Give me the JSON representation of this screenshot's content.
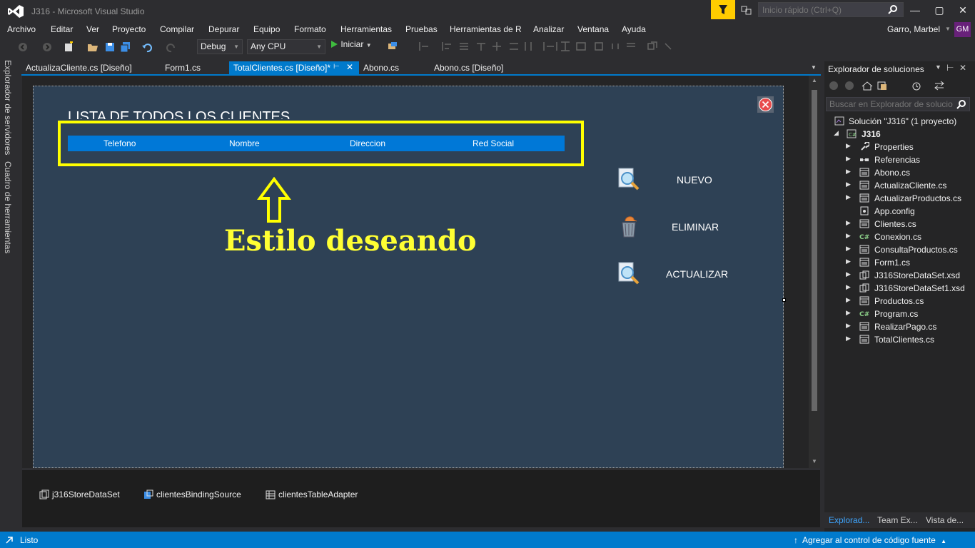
{
  "window": {
    "title": "J316 - Microsoft Visual Studio",
    "quick_launch_placeholder": "Inicio rápido (Ctrl+Q)",
    "user_name": "Garro, Marbel",
    "user_initials": "GM"
  },
  "menu": [
    "Archivo",
    "Editar",
    "Ver",
    "Proyecto",
    "Compilar",
    "Depurar",
    "Equipo",
    "Formato",
    "Herramientas",
    "Pruebas",
    "Herramientas de R",
    "Analizar",
    "Ventana",
    "Ayuda"
  ],
  "toolbar": {
    "config": "Debug",
    "platform": "Any CPU",
    "start_label": "Iniciar"
  },
  "left_tabs": [
    "Explorador de servidores",
    "Cuadro de herramientas"
  ],
  "doc_tabs": [
    {
      "label": "ActualizaCliente.cs [Diseño]",
      "active": false
    },
    {
      "label": "Form1.cs",
      "active": false
    },
    {
      "label": "TotalClientes.cs [Diseño]*",
      "active": true
    },
    {
      "label": "Abono.cs",
      "active": false
    },
    {
      "label": "Abono.cs [Diseño]",
      "active": false
    }
  ],
  "form": {
    "title": "LISTA DE TODOS LOS CLIENTES",
    "columns": [
      "Telefono",
      "Nombre",
      "Direccion",
      "Red Social"
    ],
    "annotation": "Estilo deseando",
    "buttons": [
      "NUEVO",
      "ELIMINAR",
      "ACTUALIZAR"
    ]
  },
  "tray": [
    "j316StoreDataSet",
    "clientesBindingSource",
    "clientesTableAdapter"
  ],
  "solution_explorer": {
    "title": "Explorador de soluciones",
    "search_placeholder": "Buscar en Explorador de solucio",
    "solution": "Solución \"J316\" (1 proyecto)",
    "project": "J316",
    "items": [
      {
        "label": "Properties",
        "icon": "wrench-icon",
        "expandable": true
      },
      {
        "label": "Referencias",
        "icon": "references-icon",
        "expandable": true
      },
      {
        "label": "Abono.cs",
        "icon": "form-icon",
        "expandable": true
      },
      {
        "label": "ActualizaCliente.cs",
        "icon": "form-icon",
        "expandable": true
      },
      {
        "label": "ActualizarProductos.cs",
        "icon": "form-icon",
        "expandable": true
      },
      {
        "label": "App.config",
        "icon": "config-icon",
        "expandable": false
      },
      {
        "label": "Clientes.cs",
        "icon": "form-icon",
        "expandable": true
      },
      {
        "label": "Conexion.cs",
        "icon": "csharp-icon",
        "expandable": true
      },
      {
        "label": "ConsultaProductos.cs",
        "icon": "form-icon",
        "expandable": true
      },
      {
        "label": "Form1.cs",
        "icon": "form-icon",
        "expandable": true
      },
      {
        "label": "J316StoreDataSet.xsd",
        "icon": "dataset-icon",
        "expandable": true
      },
      {
        "label": "J316StoreDataSet1.xsd",
        "icon": "dataset-icon",
        "expandable": true
      },
      {
        "label": "Productos.cs",
        "icon": "form-icon",
        "expandable": true
      },
      {
        "label": "Program.cs",
        "icon": "csharp-icon",
        "expandable": true
      },
      {
        "label": "RealizarPago.cs",
        "icon": "form-icon",
        "expandable": true
      },
      {
        "label": "TotalClientes.cs",
        "icon": "form-icon",
        "expandable": true
      }
    ],
    "bottom_tabs": [
      "Explorad...",
      "Team Ex...",
      "Vista de..."
    ]
  },
  "status": {
    "text": "Listo",
    "source_control": "Agregar al control de código fuente"
  },
  "colors": {
    "accent": "#007acc",
    "form_bg": "#2e4155",
    "grid_header": "#0078d7",
    "highlight": "#ffff00"
  }
}
